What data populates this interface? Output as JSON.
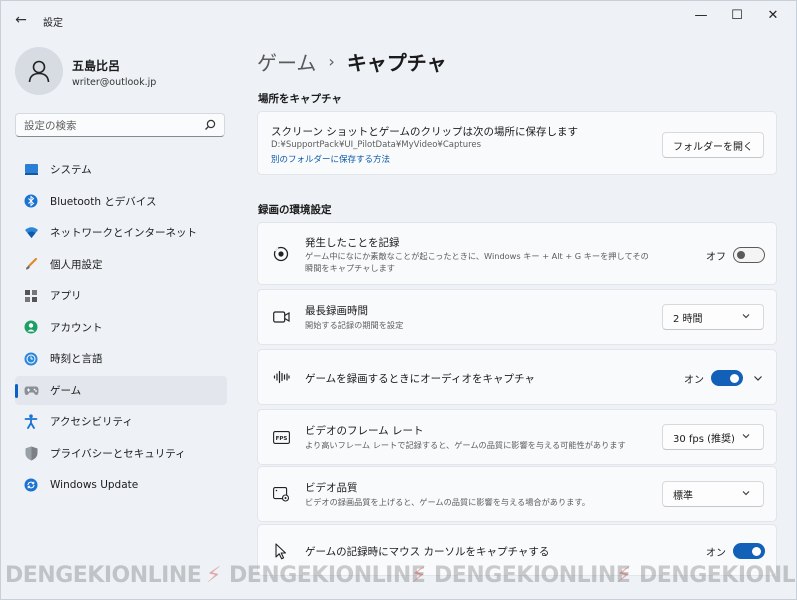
{
  "window": {
    "app_title": "設定",
    "back": "←",
    "minimize": "—",
    "maximize": "☐",
    "close": "✕"
  },
  "profile": {
    "name": "五島比呂",
    "email": "writer@outlook.jp"
  },
  "search": {
    "placeholder": "設定の検索"
  },
  "nav": {
    "items": [
      {
        "label": "システム",
        "icon": "system-icon"
      },
      {
        "label": "Bluetooth とデバイス",
        "icon": "bluetooth-icon"
      },
      {
        "label": "ネットワークとインターネット",
        "icon": "network-icon"
      },
      {
        "label": "個人用設定",
        "icon": "brush-icon"
      },
      {
        "label": "アプリ",
        "icon": "apps-icon"
      },
      {
        "label": "アカウント",
        "icon": "account-icon"
      },
      {
        "label": "時刻と言語",
        "icon": "time-language-icon"
      },
      {
        "label": "ゲーム",
        "icon": "gamepad-icon",
        "active": true
      },
      {
        "label": "アクセシビリティ",
        "icon": "accessibility-icon"
      },
      {
        "label": "プライバシーとセキュリティ",
        "icon": "shield-icon"
      },
      {
        "label": "Windows Update",
        "icon": "update-icon"
      }
    ]
  },
  "breadcrumb": {
    "parent": "ゲーム",
    "separator": "›",
    "current": "キャプチャ"
  },
  "capture_location": {
    "section_title": "場所をキャプチャ",
    "title": "スクリーン ショットとゲームのクリップは次の場所に保存します",
    "path": "D:¥SupportPack¥UI_PilotData¥MyVideo¥Captures",
    "link": "別のフォルダーに保存する方法",
    "button": "フォルダーを開く"
  },
  "recording": {
    "section_title": "録画の環境設定",
    "items": {
      "record_what_happened": {
        "title": "発生したことを記録",
        "desc_line1": "ゲーム中になにか素敵なことが起こったときに、Windows キー + Alt + G キーを押してその",
        "desc_line2": "瞬間をキャプチャします",
        "state_label": "オフ",
        "icon": "record-icon"
      },
      "max_recording_length": {
        "title": "最長録画時間",
        "desc": "開始する記録の期間を設定",
        "value": "2 時間",
        "icon": "video-camera-icon"
      },
      "capture_audio": {
        "title": "ゲームを録画するときにオーディオをキャプチャ",
        "state_label": "オン",
        "icon": "audio-wave-icon"
      },
      "frame_rate": {
        "title": "ビデオのフレーム レート",
        "desc": "より高いフレーム レートで記録すると、ゲームの品質に影響を与える可能性があります",
        "value": "30 fps (推奨)",
        "icon": "fps-icon"
      },
      "video_quality": {
        "title": "ビデオ品質",
        "desc": "ビデオの録画品質を上げると、ゲームの品質に影響を与える場合があります。",
        "value": "標準",
        "icon": "video-quality-icon"
      },
      "capture_cursor": {
        "title": "ゲームの記録時にマウス カーソルをキャプチャする",
        "state_label": "オン",
        "icon": "cursor-icon"
      }
    }
  },
  "watermark": {
    "text": "DENGEKIONLINE"
  },
  "colors": {
    "accent": "#1260b8",
    "link": "#0a5aa9",
    "background": "#eef1f6",
    "card": "#f9fafb"
  }
}
